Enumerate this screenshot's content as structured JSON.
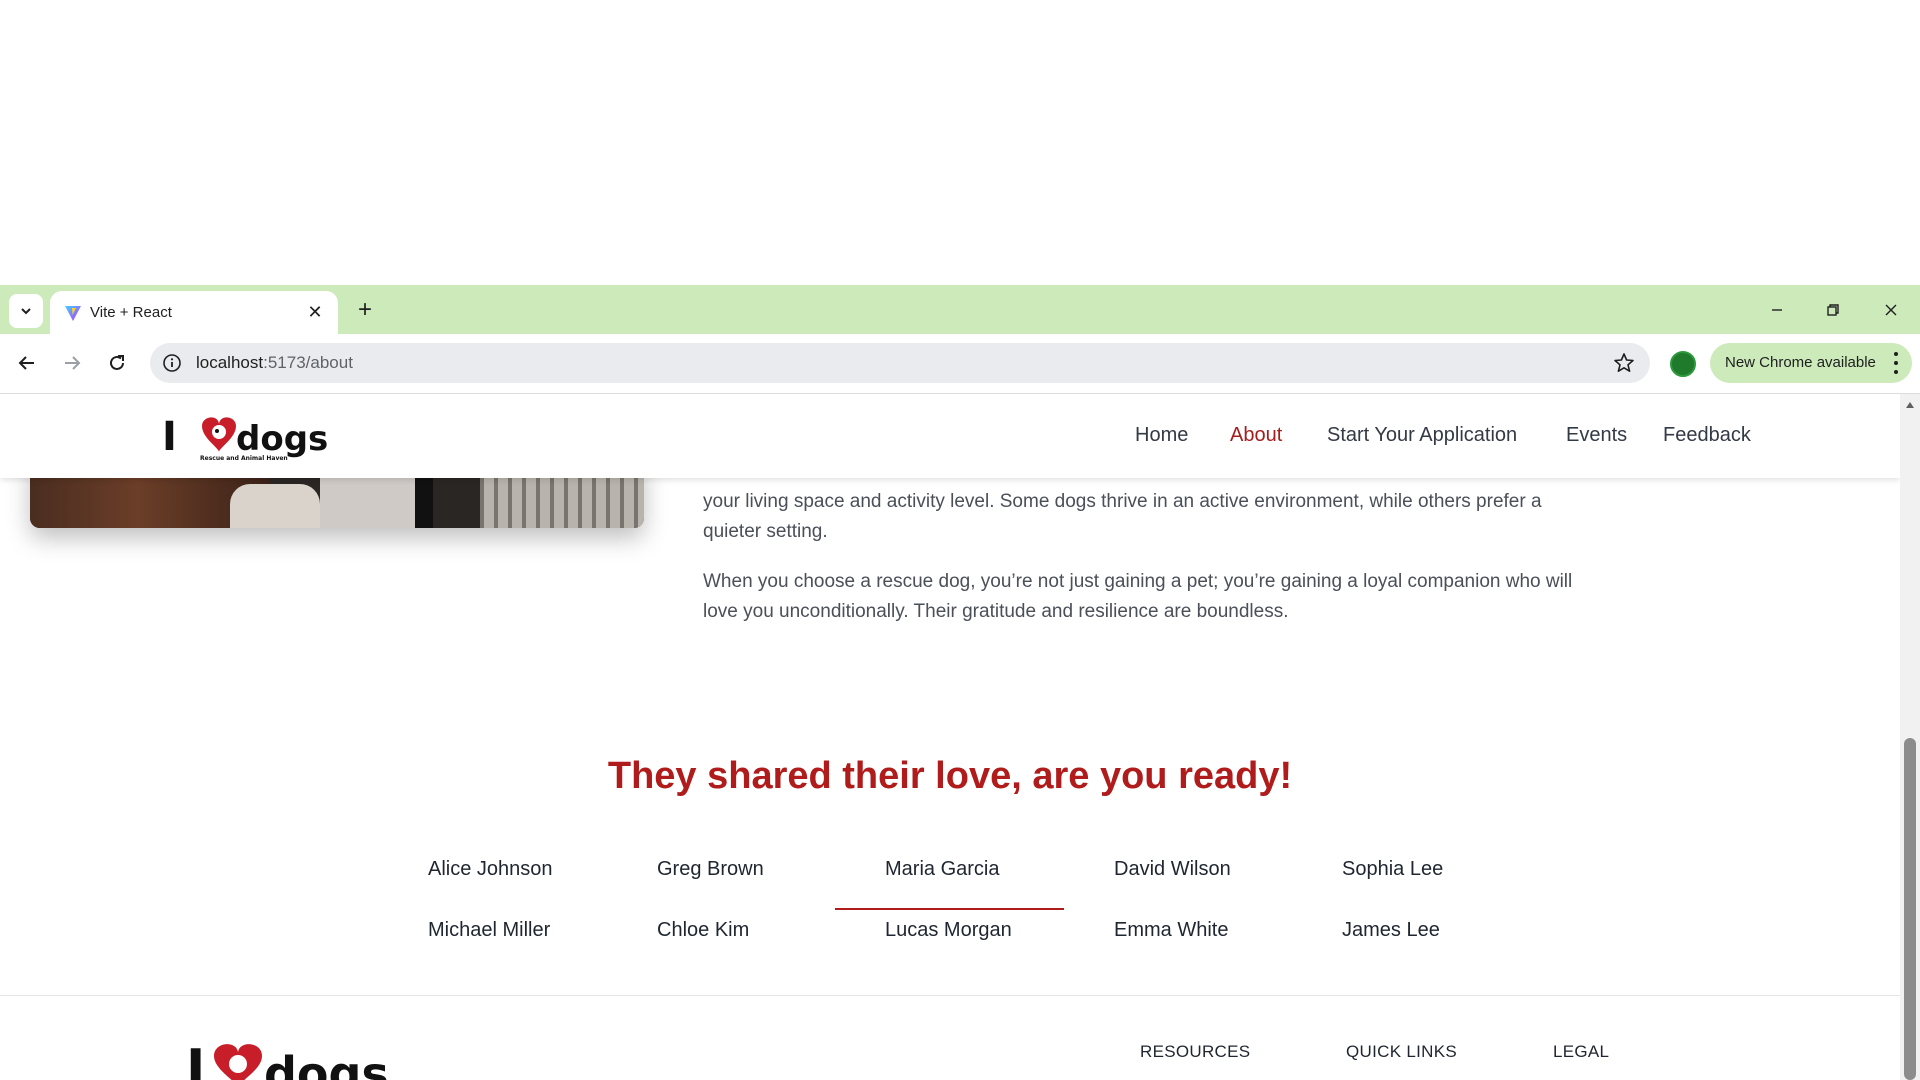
{
  "browser": {
    "tab_title": "Vite + React",
    "url_host": "localhost",
    "url_path": ":5173/about",
    "update_label": "New Chrome available"
  },
  "site": {
    "logo_i": "I",
    "logo_dogs": "dogs",
    "logo_tagline": "Rescue and Animal Haven",
    "nav": [
      "Home",
      "About",
      "Start Your Application",
      "Events",
      "Feedback"
    ],
    "active_nav": "About"
  },
  "content": {
    "para1_line1": "your living space and activity level. Some dogs thrive in an active environment, while others prefer a",
    "para1_line2": "quieter setting.",
    "para2_line1": "When you choose a rescue dog, you’re not just gaining a pet; you’re gaining a loyal companion who will",
    "para2_line2": "love you unconditionally. Their gratitude and resilience are boundless."
  },
  "testimonials": {
    "title": "They shared their love, are you ready!",
    "row1": [
      "Alice Johnson",
      "Greg Brown",
      "Maria Garcia",
      "David Wilson",
      "Sophia Lee"
    ],
    "row2": [
      "Michael Miller",
      "Chloe Kim",
      "Lucas Morgan",
      "Emma White",
      "James Lee"
    ],
    "selected": "Maria Garcia"
  },
  "footer": {
    "headings": [
      "RESOURCES",
      "QUICK LINKS",
      "LEGAL"
    ]
  },
  "colors": {
    "accent_red": "#b01c1c",
    "tabstrip_green": "#cdeabb"
  }
}
